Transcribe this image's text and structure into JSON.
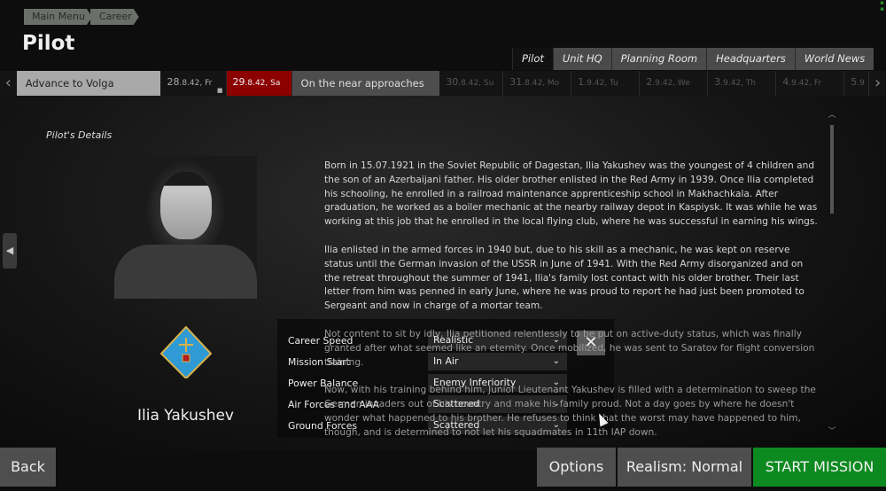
{
  "breadcrumb": [
    "Main Menu",
    "Career"
  ],
  "page_title": "Pilot",
  "tabs": [
    {
      "label": "Pilot",
      "active": true
    },
    {
      "label": "Unit HQ"
    },
    {
      "label": "Planning Room"
    },
    {
      "label": "Headquarters"
    },
    {
      "label": "World News"
    }
  ],
  "timeline": {
    "event_past": "Advance to Volga",
    "date_28": {
      "day": "28",
      "rest": ".8.42, Fr"
    },
    "date_29": {
      "day": "29",
      "rest": ".8.42, Sa"
    },
    "event_current": "On the near approaches",
    "future": [
      {
        "day": "30",
        "rest": ".8.42, Su"
      },
      {
        "day": "31",
        "rest": ".8.42, Mo"
      },
      {
        "day": "1",
        "rest": ".9.42, Tu"
      },
      {
        "day": "2",
        "rest": ".9.42, We"
      },
      {
        "day": "3",
        "rest": ".9.42, Th"
      },
      {
        "day": "4",
        "rest": ".9.42, Fr"
      },
      {
        "day": "5",
        "rest": ".9"
      }
    ],
    "current_color": "#8d0000"
  },
  "pilot": {
    "section_label": "Pilot's Details",
    "name": "Ilia Yakushev",
    "bio": [
      "Born in 15.07.1921 in the Soviet Republic of Dagestan, Ilia Yakushev was the youngest of 4 children and the son of an Azerbaijani father. His older brother enlisted in the Red Army in 1939. Once Ilia completed his schooling, he enrolled in a railroad maintenance apprenticeship school in Makhachkala. After graduation, he worked as a boiler mechanic at the nearby railway depot in Kaspiysk. It was while he was working at this job that he enrolled in the local flying club, where he was successful in earning his wings.",
      "Ilia enlisted in the armed forces in 1940 but, due to his skill as a mechanic, he was kept on reserve status until the German invasion of the USSR in June of 1941. With the Red Army disorganized and on the retreat throughout the summer of 1941, Ilia's family lost contact with his older brother. Their last letter from him was penned in early June, where he was proud to report he had just been promoted to Sergeant and now in charge of a mortar team.",
      "Not content to sit by idly, Ilia petitioned relentlessly to be put on active-duty status, which was finally granted after what seemed like an eternity. Once mobilized, he was sent to Saratov for flight conversion training.",
      "Now, with his training behind him, Junior Lieutenant Yakushev is filled with a determination to sweep the German invaders out of his country and make his family proud. Not a day goes by where he doesn't wonder what happened to his brother. He refuses to think that the worst may have happened to him, though, and is determined to not let his squadmates in 11th IAP down."
    ]
  },
  "options": [
    {
      "label": "Career Speed",
      "value": "Realistic"
    },
    {
      "label": "Mission Start",
      "value": "In Air"
    },
    {
      "label": "Power Balance",
      "value": "Enemy Inferiority"
    },
    {
      "label": "Air Forces and AAA",
      "value": "Scattered"
    },
    {
      "label": "Ground Forces",
      "value": "Scattered"
    }
  ],
  "buttons": {
    "back": "Back",
    "options": "Options",
    "realism": "Realism: Normal",
    "start": "START MISSION",
    "close": "✕"
  },
  "colors": {
    "start": "#0d8a1f"
  }
}
